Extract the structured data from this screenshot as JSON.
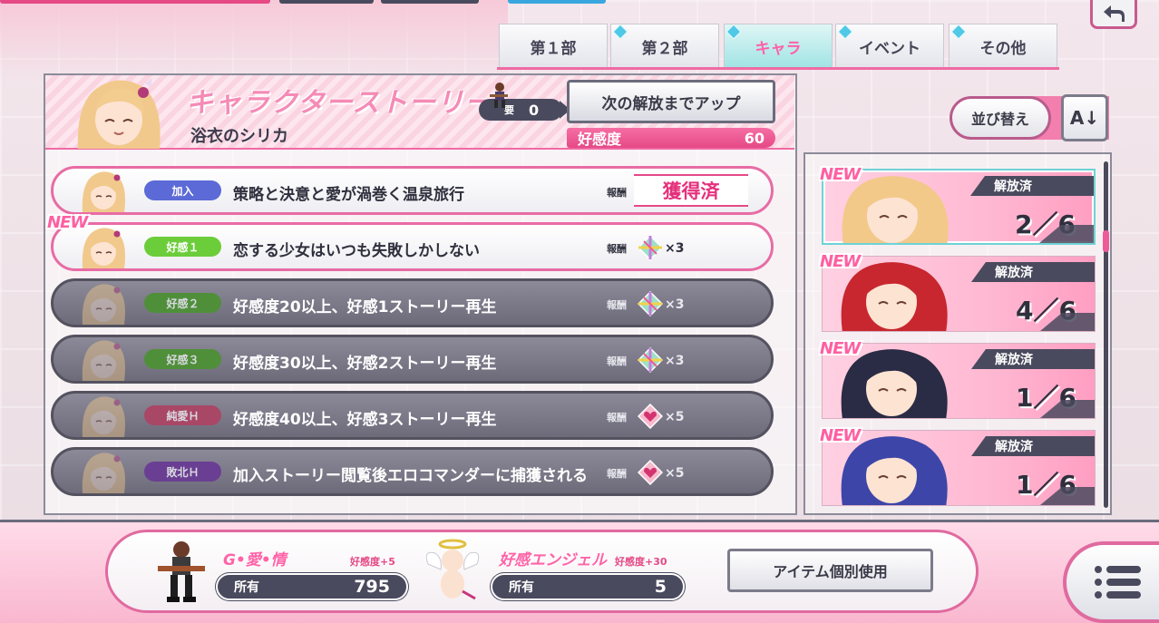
{
  "tabs": [
    {
      "label": "第１部",
      "diamond": false,
      "active": false
    },
    {
      "label": "第２部",
      "diamond": true,
      "active": false
    },
    {
      "label": "キャラ",
      "diamond": true,
      "active": true
    },
    {
      "label": "イベント",
      "diamond": true,
      "active": false
    },
    {
      "label": "その他",
      "diamond": true,
      "active": false
    }
  ],
  "header": {
    "title": "キャラクターストーリー",
    "character_name": "浴衣のシリカ",
    "requirement_label": "要",
    "requirement_value": "0",
    "unlock_button": "次の解放までアップ",
    "affection_label": "好感度",
    "affection_value": "60"
  },
  "stories": [
    {
      "tag": "加入",
      "tag_color": "#5b6ad6",
      "title": "策略と決意と愛が渦巻く温泉旅行",
      "reward_label": "報酬",
      "obtained": "獲得済",
      "reward_qty": "",
      "reward_icon": "none",
      "locked": false,
      "new": false
    },
    {
      "tag": "好感１",
      "tag_color": "#6ccd3a",
      "title": "恋する少女はいつも失敗しかしない",
      "reward_label": "報酬",
      "obtained": "",
      "reward_qty": "×3",
      "reward_icon": "crystal-icon",
      "locked": false,
      "new": true
    },
    {
      "tag": "好感２",
      "tag_color": "#4f8f3a",
      "title": "好感度20以上、好感1ストーリー再生",
      "reward_label": "報酬",
      "obtained": "",
      "reward_qty": "×3",
      "reward_icon": "crystal-icon",
      "locked": true,
      "new": false
    },
    {
      "tag": "好感３",
      "tag_color": "#4f8f3a",
      "title": "好感度30以上、好感2ストーリー再生",
      "reward_label": "報酬",
      "obtained": "",
      "reward_qty": "×3",
      "reward_icon": "crystal-icon",
      "locked": true,
      "new": false
    },
    {
      "tag": "純愛Ｈ",
      "tag_color": "#a94767",
      "title": "好感度40以上、好感3ストーリー再生",
      "reward_label": "報酬",
      "obtained": "",
      "reward_qty": "×5",
      "reward_icon": "heart-gem-icon",
      "locked": true,
      "new": false
    },
    {
      "tag": "敗北Ｈ",
      "tag_color": "#6a3f93",
      "title": "加入ストーリー閲覧後エロコマンダーに捕獲される",
      "reward_label": "報酬",
      "obtained": "",
      "reward_qty": "×5",
      "reward_icon": "heart-gem-icon",
      "locked": true,
      "new": false
    }
  ],
  "new_label": "NEW",
  "sort": {
    "label": "並び替え",
    "dir_icon": "A↓"
  },
  "characters": [
    {
      "status": "解放済",
      "count": "2／6",
      "hair": "#f3c98a",
      "selected": true
    },
    {
      "status": "解放済",
      "count": "4／6",
      "hair": "#c8272f",
      "selected": false
    },
    {
      "status": "解放済",
      "count": "1／6",
      "hair": "#2a2b44",
      "selected": false
    },
    {
      "status": "解放済",
      "count": "1／6",
      "hair": "#3d46a8",
      "selected": false
    }
  ],
  "items": [
    {
      "name": "G•愛•情",
      "bonus": "好感度+5",
      "own_label": "所有",
      "own_value": "795"
    },
    {
      "name": "好感エンジェル",
      "bonus": "好感度+30",
      "own_label": "所有",
      "own_value": "5"
    }
  ],
  "use_item_button": "アイテム個別使用",
  "colors": {
    "accent_pink": "#ef6aa3",
    "panel_dark": "#4a4a5e",
    "active_tab": "#9fe3e4"
  }
}
